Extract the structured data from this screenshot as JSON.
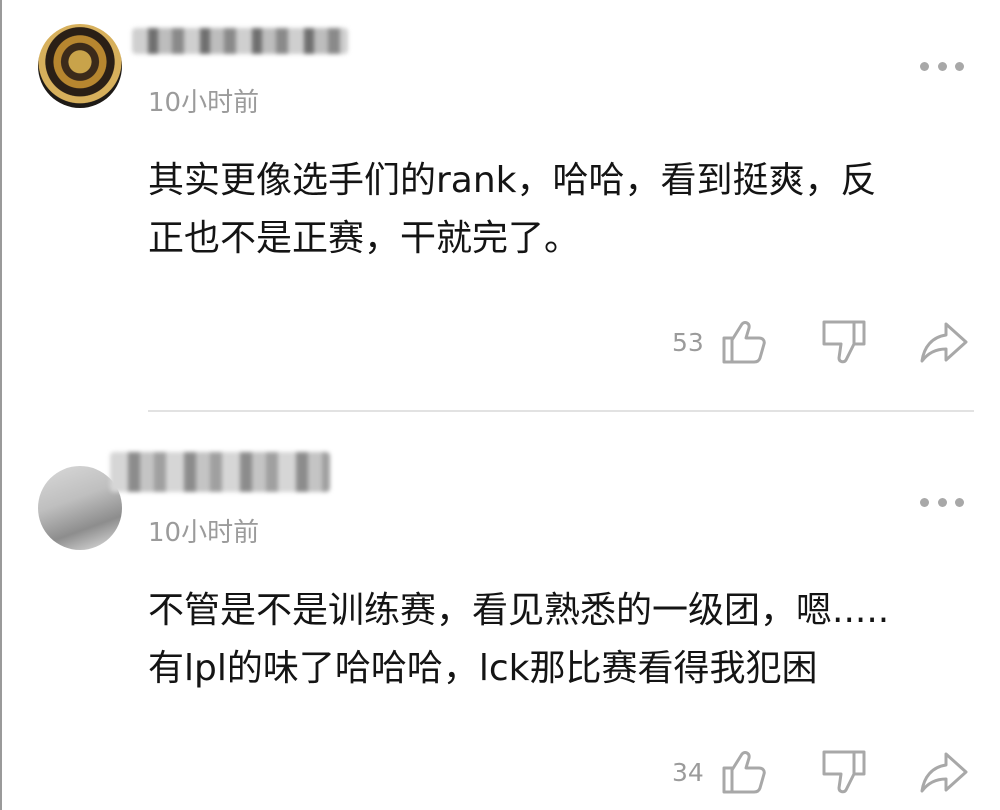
{
  "comments": [
    {
      "timestamp": "10小时前",
      "text_lines": [
        "其实更像选手们的rank，哈哈，看到挺爽，反",
        "正也不是正赛，干就完了。"
      ],
      "like_count": "53"
    },
    {
      "timestamp": "10小时前",
      "text_lines": [
        "不管是不是训练赛，看见熟悉的一级团，嗯.....",
        "有lpl的味了哈哈哈，lck那比赛看得我犯困"
      ],
      "like_count": "34"
    }
  ],
  "icons": {
    "more": "more-dots-icon",
    "like": "thumbs-up-icon",
    "dislike": "thumbs-down-icon",
    "share": "share-arrow-icon"
  },
  "colors": {
    "text": "#141414",
    "meta": "#9b9b9b",
    "icon": "#a8a8a8",
    "divider": "#e2e2e2"
  }
}
